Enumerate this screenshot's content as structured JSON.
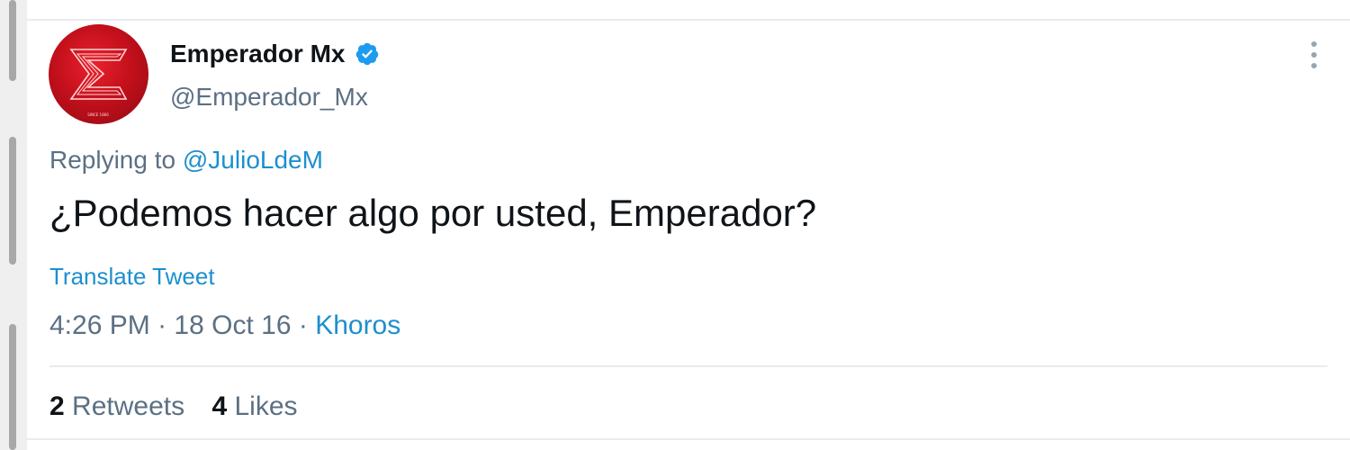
{
  "tweet": {
    "display_name": "Emperador Mx",
    "verified": true,
    "handle": "@Emperador_Mx",
    "reply_prefix": "Replying to",
    "reply_to": "@JulioLdeM",
    "text": "¿Podemos hacer algo por usted, Emperador?",
    "translate_label": "Translate Tweet",
    "time": "4:26 PM",
    "date": "18 Oct 16",
    "separator": "·",
    "source": "Khoros",
    "retweets_count": "2",
    "retweets_label": "Retweets",
    "likes_count": "4",
    "likes_label": "Likes"
  },
  "icons": {
    "verified": "verified-badge-icon",
    "more": "more-vertical-icon",
    "avatar": "emperador-logo"
  },
  "colors": {
    "accent": "#1d8fcf",
    "text_primary": "#0f1419",
    "text_secondary": "#5b7083",
    "avatar_red": "#c4101c"
  }
}
